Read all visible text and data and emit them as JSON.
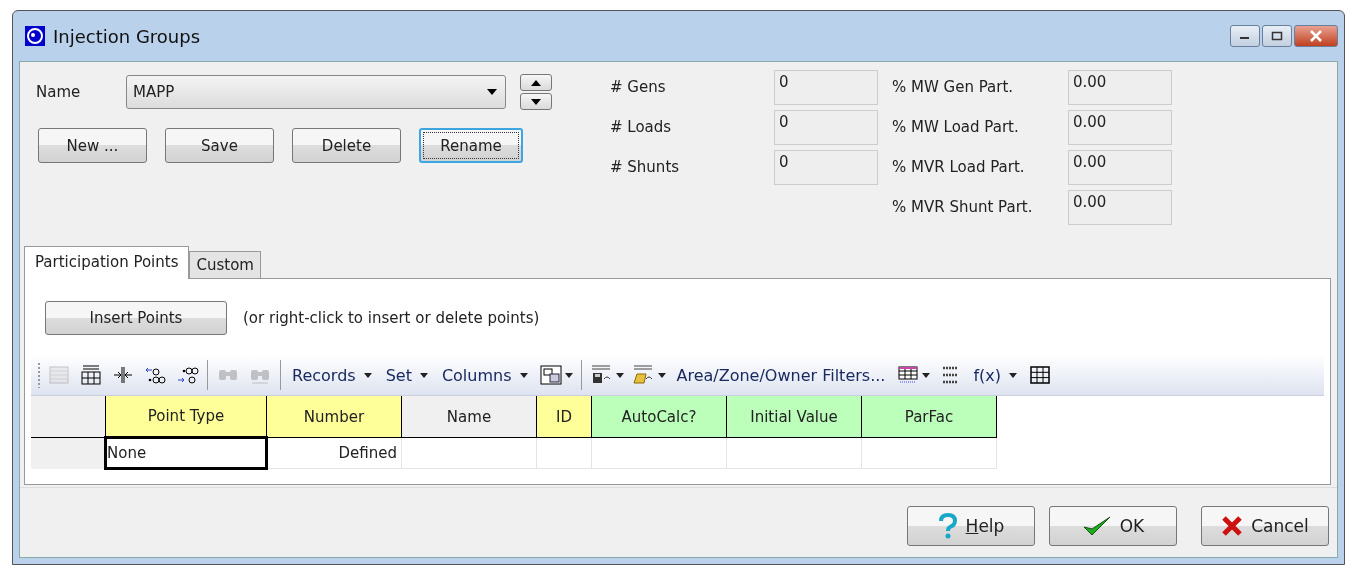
{
  "window": {
    "title": "Injection Groups"
  },
  "name_field": {
    "label": "Name",
    "value": "MAPP"
  },
  "group_buttons": [
    {
      "label": "New ...",
      "focused": false
    },
    {
      "label": "Save",
      "focused": false
    },
    {
      "label": "Delete",
      "focused": false
    },
    {
      "label": "Rename",
      "focused": true
    }
  ],
  "counts": [
    {
      "label": "# Gens",
      "value": "0"
    },
    {
      "label": "# Loads",
      "value": "0"
    },
    {
      "label": "# Shunts",
      "value": "0"
    }
  ],
  "participation": [
    {
      "label": "% MW Gen Part.",
      "value": "0.00"
    },
    {
      "label": "% MW Load Part.",
      "value": "0.00"
    },
    {
      "label": "% MVR Load Part.",
      "value": "0.00"
    },
    {
      "label": "% MVR Shunt Part.",
      "value": "0.00"
    }
  ],
  "tabs": [
    {
      "label": "Participation Points",
      "selected": true
    },
    {
      "label": "Custom",
      "selected": false
    }
  ],
  "insert_button": {
    "label": "Insert Points"
  },
  "insert_hint": "(or right-click to insert or delete points)",
  "toolbar": [
    {
      "kind": "icon",
      "disabled": true,
      "dropdown": false
    },
    {
      "kind": "icon",
      "disabled": false,
      "dropdown": false
    },
    {
      "kind": "icon",
      "disabled": false,
      "dropdown": false
    },
    {
      "kind": "icon",
      "disabled": false,
      "dropdown": false
    },
    {
      "kind": "icon",
      "disabled": false,
      "dropdown": false
    },
    {
      "kind": "separator"
    },
    {
      "kind": "icon",
      "disabled": true,
      "dropdown": false
    },
    {
      "kind": "icon",
      "disabled": true,
      "dropdown": false
    },
    {
      "kind": "separator"
    },
    {
      "kind": "menu",
      "label": "Records"
    },
    {
      "kind": "menu",
      "label": "Set"
    },
    {
      "kind": "menu",
      "label": "Columns"
    },
    {
      "kind": "icon",
      "disabled": false,
      "dropdown": true
    },
    {
      "kind": "separator"
    },
    {
      "kind": "icon",
      "disabled": false,
      "dropdown": true
    },
    {
      "kind": "icon",
      "disabled": false,
      "dropdown": true
    },
    {
      "kind": "link",
      "label": "Area/Zone/Owner Filters..."
    },
    {
      "kind": "icon",
      "disabled": false,
      "dropdown": true
    },
    {
      "kind": "icon",
      "disabled": false,
      "dropdown": false
    },
    {
      "kind": "menu",
      "label": "f(x)"
    },
    {
      "kind": "icon",
      "disabled": false,
      "dropdown": false
    }
  ],
  "table": {
    "columns": [
      {
        "label": "Point Type",
        "color": "#ffff99"
      },
      {
        "label": "Number",
        "color": "#ffff99"
      },
      {
        "label": "Name",
        "color": "#f0f0f0"
      },
      {
        "label": "ID",
        "color": "#ffff99"
      },
      {
        "label": "AutoCalc?",
        "color": "#bbffbb"
      },
      {
        "label": "Initial Value",
        "color": "#bbffbb"
      },
      {
        "label": "ParFac",
        "color": "#bbffbb"
      }
    ],
    "rows": [
      {
        "cells": [
          "None",
          "Defined",
          "",
          "",
          "",
          "",
          ""
        ],
        "selected": true
      }
    ]
  },
  "dialog_buttons": [
    {
      "kind": "help",
      "label": "Help",
      "underline_first": true
    },
    {
      "kind": "ok",
      "label": "OK",
      "underline_first": false
    },
    {
      "kind": "cancel",
      "label": "Cancel",
      "underline_first": false
    }
  ]
}
